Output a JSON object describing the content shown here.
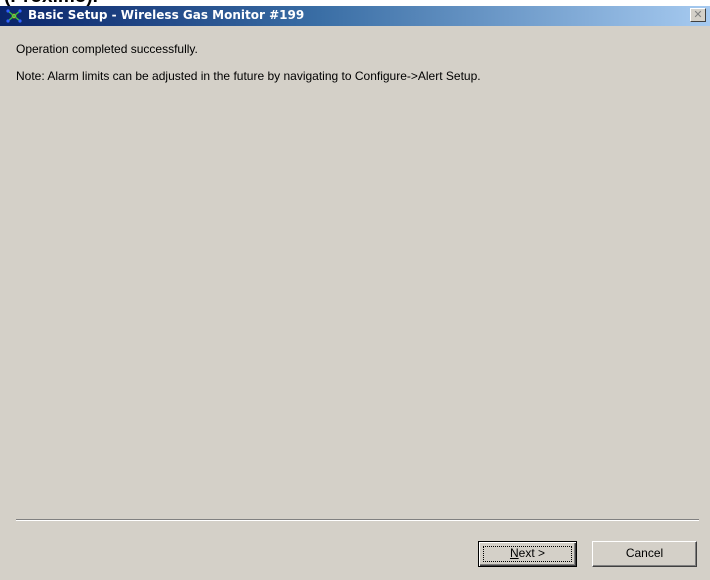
{
  "header_clip": "(Proximo).",
  "window": {
    "title": "Basic Setup - Wireless Gas Monitor #199",
    "close_symbol": "✕",
    "icon": "app-network-icon"
  },
  "content": {
    "status_message": "Operation completed successfully.",
    "note": "Note: Alarm limits can be adjusted in the future by navigating to Configure->Alert Setup."
  },
  "buttons": {
    "next_mnemonic": "N",
    "next_rest": "ext >",
    "cancel": "Cancel"
  }
}
